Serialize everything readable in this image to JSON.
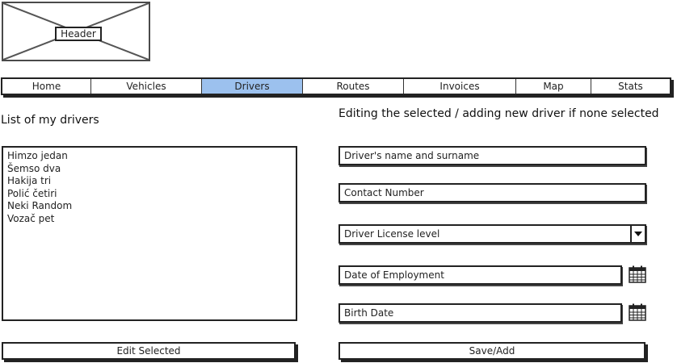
{
  "header": {
    "label": "Header"
  },
  "nav": {
    "tabs": [
      {
        "label": "Home",
        "active": false
      },
      {
        "label": "Vehicles",
        "active": false
      },
      {
        "label": "Drivers",
        "active": true
      },
      {
        "label": "Routes",
        "active": false
      },
      {
        "label": "Invoices",
        "active": false
      },
      {
        "label": "Map",
        "active": false
      },
      {
        "label": "Stats",
        "active": false
      }
    ],
    "active_color": "#9cc1ee"
  },
  "list_panel": {
    "title": "List of my drivers",
    "drivers": [
      "Himzo jedan",
      "Šemso dva",
      "Hakija tri",
      "Polić četiri",
      "Neki Random",
      "Vozač pet"
    ],
    "edit_button": "Edit Selected"
  },
  "form_panel": {
    "title": "Editing the selected / adding new driver if none selected",
    "name_field": "Driver's name and surname",
    "contact_field": "Contact Number",
    "license_select": "Driver License level",
    "employment_date_field": "Date of Employment",
    "birth_date_field": "Birth Date",
    "save_button": "Save/Add",
    "calendar_icon": "calendar-icon"
  }
}
